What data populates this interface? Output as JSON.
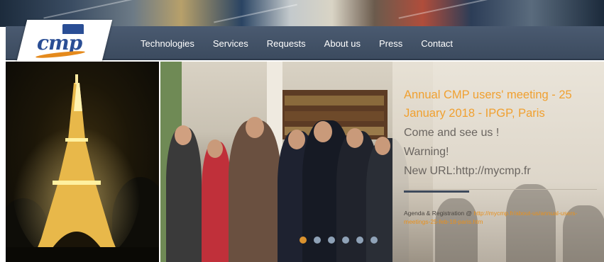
{
  "brand": {
    "logo_text": "cmp"
  },
  "nav": {
    "items": [
      {
        "label": "Technologies"
      },
      {
        "label": "Services"
      },
      {
        "label": "Requests"
      },
      {
        "label": "About us"
      },
      {
        "label": "Press"
      },
      {
        "label": "Contact"
      }
    ]
  },
  "slide": {
    "headline": "Annual CMP users' meeting - 25 January 2018 - IPGP, Paris",
    "line1": "Come and see us !",
    "line2": "Warning!",
    "line3": "New URL:http://mycmp.fr",
    "agenda_prefix": "Agenda & Registration @ ",
    "agenda_link": "http://mycmp.fr/about-us/annual-users-meetings-25-feb-18-paris.htm"
  },
  "slider": {
    "dot_count": 6,
    "active_index": 0
  },
  "colors": {
    "accent": "#f0a030",
    "nav_bg": "#44546a",
    "logo_blue": "#2a4e95"
  }
}
